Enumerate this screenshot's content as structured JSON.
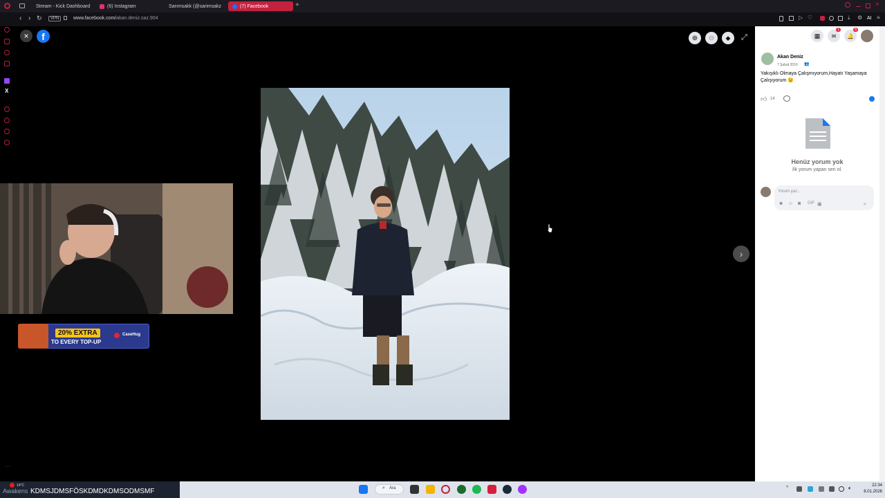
{
  "browser": {
    "tabs": [
      {
        "label": "Stream - Kick Dashboard",
        "color": "#53fc18"
      },
      {
        "label": "(6) Instagram",
        "color": "#e1306c"
      },
      {
        "label": "Sarımsakk (@sarimsakz",
        "color": "#ffffff"
      },
      {
        "label": "(7) Facebook",
        "color": "#1877f2"
      }
    ],
    "vpn_label": "VPN",
    "url_host": "www.facebook.com/",
    "url_path": "akan.deniz.saz.904",
    "ai_label": "AI"
  },
  "post": {
    "author": "Akan Deniz",
    "date": "7 Şubat 2016",
    "caption": "Yakışıklı Olmaya Çalışmıyorum,Hayatı Yaşamaya Çalışıyorum 😉",
    "like_count": "14",
    "no_comments_title": "Henüz yorum yok",
    "no_comments_sub": "İlk yorum yapan sen ol.",
    "comment_placeholder": "Yorum yaz..."
  },
  "header": {
    "messenger_badge": "1",
    "notif_badge": "6"
  },
  "overlay": {
    "promo_line1": "20% EXTRA",
    "promo_line2": "TO EVERY TOP-UP",
    "promo_brand": "CaseHug"
  },
  "taskbar": {
    "ticker": "KDMSJDMSFÖSKDMDKDMSODMSMF",
    "ticker_prefix": "Awakens",
    "weather": "14°C",
    "search_label": "Ara",
    "time": "22:34",
    "date": "8.01.2026"
  },
  "colors": {
    "opera_red": "#c4213e",
    "facebook_blue": "#1877f2"
  }
}
